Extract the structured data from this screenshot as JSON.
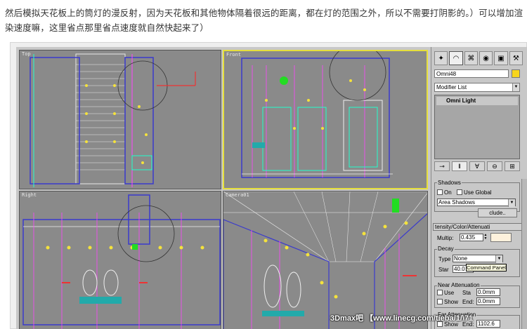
{
  "article": {
    "intro_text": "然后模拟天花板上的筒灯的漫反射，因为天花板和其他物体隔着很远的距离，都在灯的范围之外，所以不需要打阴影的。）可以增加渲染速度嘛，这里省点那里省点速度就自然快起来了）"
  },
  "viewports": {
    "top": "Top",
    "front": "Front",
    "right": "Right",
    "camera": "Camera01"
  },
  "command_panel": {
    "tab_icons": [
      "create-icon",
      "modify-icon",
      "hierarchy-icon",
      "motion-icon",
      "display-icon",
      "utilities-icon"
    ],
    "object_name": "Omni48",
    "color_swatch": "#f7d51d",
    "modifier_list": "Modifier List",
    "stack_item": "Omni Light",
    "shadows": {
      "title": "Shadows",
      "on_label": "On",
      "use_global_label": "Use Global",
      "type_value": "Area Shadows",
      "exclude_button": "clude.."
    },
    "intensity": {
      "header": "tensity/Color/Attenuati",
      "multiplier_label": "Multip:",
      "multiplier_value": "0.435"
    },
    "decay": {
      "title": "Decay",
      "type_label": "Type",
      "type_value": "None",
      "start_label": "Star",
      "start_value": "40.0"
    },
    "near_attenuation": {
      "title": "Near Attenuation",
      "use_label": "Use",
      "show_label": "Show",
      "start_label": "Sta",
      "start_value": "0.0mm",
      "end_label": "End:",
      "end_value": "0.0mm"
    },
    "far_attenuation": {
      "title": "Far Attenuation",
      "show_label": "Show",
      "end_label": "End:",
      "end_value": "1102.6"
    },
    "tooltip": "Command Panel"
  },
  "watermark": "3Dmax吧 【www.linecg.com/tieba/1/\\71"
}
